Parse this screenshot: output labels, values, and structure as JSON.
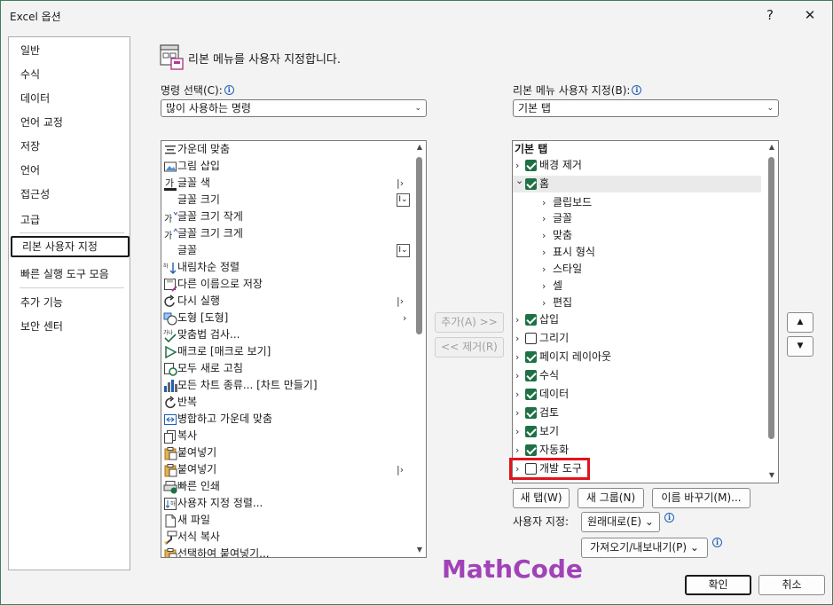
{
  "window": {
    "title": "Excel 옵션",
    "help_glyph": "?",
    "close_glyph": "✕"
  },
  "nav": {
    "items": [
      {
        "label": "일반"
      },
      {
        "label": "수식"
      },
      {
        "label": "데이터"
      },
      {
        "label": "언어 교정"
      },
      {
        "label": "저장"
      },
      {
        "label": "언어"
      },
      {
        "label": "접근성"
      },
      {
        "label": "고급"
      },
      {
        "label": "리본 사용자 지정",
        "active": true
      },
      {
        "label": "빠른 실행 도구 모음"
      },
      {
        "label": "추가 기능"
      },
      {
        "label": "보안 센터"
      }
    ]
  },
  "header": {
    "text": "리본 메뉴를 사용자 지정합니다."
  },
  "left": {
    "label": "명령 선택(C):",
    "select_value": "많이 사용하는 명령",
    "commands": [
      {
        "label": "가운데 맞춤",
        "icon": "align-center-icon"
      },
      {
        "label": "그림 삽입",
        "icon": "picture-icon"
      },
      {
        "label": "글꼴 색",
        "icon": "font-color-icon",
        "glyph": "|>"
      },
      {
        "label": "글꼴 크기",
        "icon": "",
        "glyph": "I~"
      },
      {
        "label": "글꼴 크기 작게",
        "icon": "font-decrease-icon"
      },
      {
        "label": "글꼴 크기 크게",
        "icon": "font-increase-icon"
      },
      {
        "label": "글꼴",
        "icon": "",
        "glyph": "I~"
      },
      {
        "label": "내림차순 정렬",
        "icon": "sort-desc-icon"
      },
      {
        "label": "다른 이름으로 저장",
        "icon": "save-as-icon"
      },
      {
        "label": "다시 실행",
        "icon": "redo-icon",
        "glyph": "|>"
      },
      {
        "label": "도형 [도형]",
        "icon": "shapes-icon",
        "glyph": ">"
      },
      {
        "label": "맞춤법 검사...",
        "icon": "spelling-icon"
      },
      {
        "label": "매크로 [매크로 보기]",
        "icon": "macro-icon"
      },
      {
        "label": "모두 새로 고침",
        "icon": "refresh-icon"
      },
      {
        "label": "모든 차트 종류... [차트 만들기]",
        "icon": "chart-icon"
      },
      {
        "label": "반복",
        "icon": "repeat-icon"
      },
      {
        "label": "병합하고 가운데 맞춤",
        "icon": "merge-icon"
      },
      {
        "label": "복사",
        "icon": "copy-icon"
      },
      {
        "label": "붙여넣기",
        "icon": "paste-icon"
      },
      {
        "label": "붙여넣기",
        "icon": "paste-icon",
        "glyph": "|>"
      },
      {
        "label": "빠른 인쇄",
        "icon": "quick-print-icon"
      },
      {
        "label": "사용자 지정 정렬...",
        "icon": "custom-sort-icon"
      },
      {
        "label": "새 파일",
        "icon": "new-file-icon"
      },
      {
        "label": "서식 복사",
        "icon": "format-painter-icon"
      },
      {
        "label": "선택하여 붙여넣기...",
        "icon": "paste-special-icon"
      }
    ]
  },
  "middle": {
    "add_label": "추가(A) >>",
    "remove_label": "<< 제거(R)"
  },
  "right": {
    "label": "리본 메뉴 사용자 지정(B):",
    "select_value": "기본 탭",
    "tree_header": "기본 탭",
    "tree": [
      {
        "label": "배경 제거",
        "level": 0,
        "expander": ">",
        "checked": true
      },
      {
        "label": "홈",
        "level": 0,
        "expander": "v",
        "checked": true,
        "selected": true
      },
      {
        "label": "클립보드",
        "level": 1,
        "expander": ">"
      },
      {
        "label": "글꼴",
        "level": 1,
        "expander": ">"
      },
      {
        "label": "맞춤",
        "level": 1,
        "expander": ">"
      },
      {
        "label": "표시 형식",
        "level": 1,
        "expander": ">"
      },
      {
        "label": "스타일",
        "level": 1,
        "expander": ">"
      },
      {
        "label": "셀",
        "level": 1,
        "expander": ">"
      },
      {
        "label": "편집",
        "level": 1,
        "expander": ">"
      },
      {
        "label": "삽입",
        "level": 0,
        "expander": ">",
        "checked": true
      },
      {
        "label": "그리기",
        "level": 0,
        "expander": ">",
        "checked": false
      },
      {
        "label": "페이지 레이아웃",
        "level": 0,
        "expander": ">",
        "checked": true
      },
      {
        "label": "수식",
        "level": 0,
        "expander": ">",
        "checked": true
      },
      {
        "label": "데이터",
        "level": 0,
        "expander": ">",
        "checked": true
      },
      {
        "label": "검토",
        "level": 0,
        "expander": ">",
        "checked": true
      },
      {
        "label": "보기",
        "level": 0,
        "expander": ">",
        "checked": true
      },
      {
        "label": "자동화",
        "level": 0,
        "expander": ">",
        "checked": true
      },
      {
        "label": "개발 도구",
        "level": 0,
        "expander": ">",
        "checked": false
      }
    ],
    "move_up": "▲",
    "move_down": "▼",
    "new_tab_label": "새 탭(W)",
    "new_group_label": "새 그룹(N)",
    "rename_label": "이름 바꾸기(M)...",
    "customize_label": "사용자 지정:",
    "reset_label": "원래대로(E) ⌄",
    "import_export_label": "가져오기/내보내기(P) ⌄"
  },
  "footer": {
    "ok_label": "확인",
    "cancel_label": "취소"
  },
  "watermark": "MathCode",
  "colors": {
    "check_green": "#1e7145",
    "highlight_red": "#e0141e",
    "watermark_purple": "#a142b8"
  }
}
